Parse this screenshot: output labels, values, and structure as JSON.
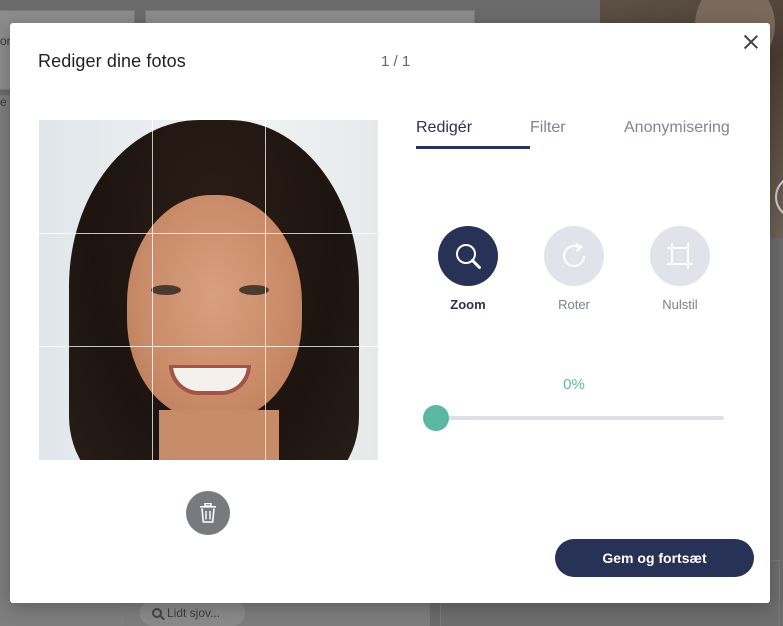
{
  "modal": {
    "title": "Rediger dine fotos",
    "counter": "1 / 1"
  },
  "tabs": [
    {
      "label": "Redigér",
      "active": true
    },
    {
      "label": "Filter",
      "active": false
    },
    {
      "label": "Anonymisering",
      "active": false
    }
  ],
  "tools": [
    {
      "label": "Zoom",
      "icon": "search-icon",
      "active": true
    },
    {
      "label": "Roter",
      "icon": "rotate-icon",
      "active": false
    },
    {
      "label": "Nulstil",
      "icon": "crop-reset-icon",
      "active": false
    }
  ],
  "zoom": {
    "value_label": "0%",
    "value": 0
  },
  "actions": {
    "save_label": "Gem og fortsæt"
  },
  "background": {
    "text_1": "or",
    "text_2": "e",
    "search_label": "Lidt sjov..."
  },
  "colors": {
    "primary": "#283257",
    "accent": "#5ab7a2",
    "tool_inactive": "#e0e4ea",
    "trash": "#777b80"
  }
}
